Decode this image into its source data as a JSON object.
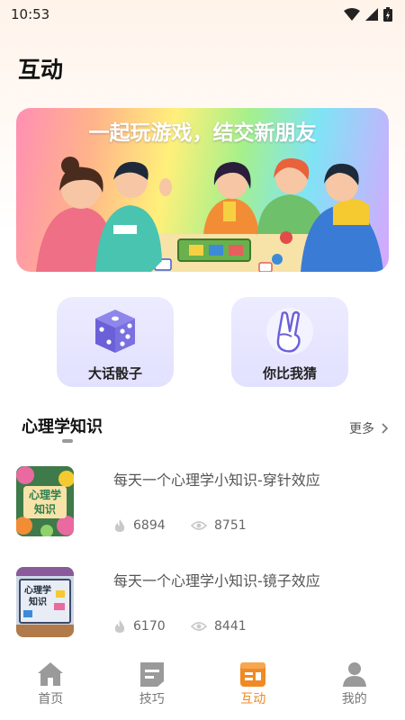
{
  "status_bar": {
    "time": "10:53"
  },
  "page": {
    "title": "互动"
  },
  "banner": {
    "headline": "一起玩游戏，结交新朋友"
  },
  "games": [
    {
      "label": "大话骰子",
      "icon": "dice-icon"
    },
    {
      "label": "你比我猜",
      "icon": "victory-hand-icon"
    }
  ],
  "psychology": {
    "title": "心理学知识",
    "more": "更多",
    "articles": [
      {
        "title": "每天一个心理学小知识-穿针效应",
        "likes": "6894",
        "views": "8751",
        "thumb_text": "心理学知识"
      },
      {
        "title": "每天一个心理学小知识-镜子效应",
        "likes": "6170",
        "views": "8441",
        "thumb_text": "心理学知识"
      }
    ]
  },
  "tab_bar": {
    "active_color": "#f08a24",
    "tabs": [
      {
        "label": "首页",
        "icon": "home-icon"
      },
      {
        "label": "技巧",
        "icon": "tips-icon"
      },
      {
        "label": "互动",
        "icon": "interaction-icon"
      },
      {
        "label": "我的",
        "icon": "profile-icon"
      }
    ]
  }
}
